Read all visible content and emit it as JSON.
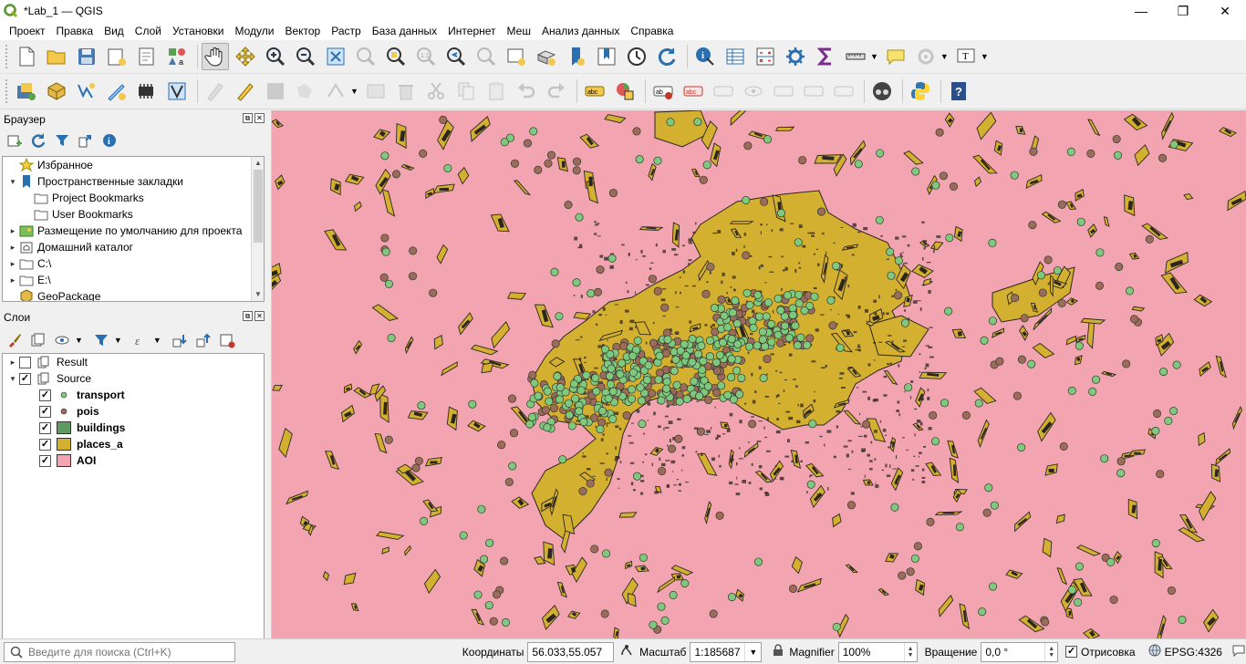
{
  "window": {
    "title": "*Lab_1 — QGIS",
    "minimize": "—",
    "maximize": "❐",
    "close": "✕"
  },
  "menu": [
    {
      "label": "Проект"
    },
    {
      "label": "Правка"
    },
    {
      "label": "Вид"
    },
    {
      "label": "Слой"
    },
    {
      "label": "Установки"
    },
    {
      "label": "Модули"
    },
    {
      "label": "Вектор"
    },
    {
      "label": "Растр"
    },
    {
      "label": "База данных"
    },
    {
      "label": "Интернет"
    },
    {
      "label": "Меш"
    },
    {
      "label": "Анализ данных"
    },
    {
      "label": "Справка"
    }
  ],
  "toolbar1": [
    "new-project-icon",
    "open-project-icon",
    "save-project-icon",
    "new-print-layout-icon",
    "layout-manager-icon",
    "style-manager-icon",
    "pan-icon",
    "pan-to-selection-icon",
    "zoom-in-icon",
    "zoom-out-icon",
    "zoom-full-icon",
    "zoom-to-selection-icon",
    "zoom-to-layer-icon",
    "zoom-native-icon",
    "zoom-last-icon",
    "zoom-next-icon",
    "new-map-view-icon",
    "new-3d-view-icon",
    "new-bookmark-icon",
    "show-bookmarks-icon",
    "temporal-controller-icon",
    "refresh-icon",
    "identify-icon",
    "attribute-table-icon",
    "field-calculator-icon",
    "processing-toolbox-icon",
    "statistics-icon",
    "measure-icon",
    "map-tips-icon",
    "select-icon",
    "text-annotation-icon"
  ],
  "toolbar2": [
    "data-source-manager-icon",
    "new-geopackage-layer-icon",
    "new-shapefile-layer-icon",
    "new-temporary-layer-icon",
    "new-spatialite-layer-icon",
    "digitize-toggle-icon",
    "current-edits-icon",
    "toggle-editing-icon",
    "save-edits-icon",
    "add-feature-icon",
    "vertex-tool-icon",
    "modify-attributes-icon",
    "delete-selected-icon",
    "cut-features-icon",
    "copy-features-icon",
    "paste-features-icon",
    "undo-icon",
    "redo-icon",
    "label-toolbar-icon",
    "diagram-icon",
    "layer-labeling-icon",
    "highlight-pinned-labels-icon",
    "pin-labels-icon",
    "show-hide-labels-icon",
    "move-label-icon",
    "rotate-label-icon",
    "change-label-icon",
    "osm-icon",
    "python-console-icon",
    "help-icon"
  ],
  "browser": {
    "title": "Браузер",
    "items": [
      {
        "label": "Избранное",
        "icon": "star-icon",
        "arrow": "",
        "indent": 0
      },
      {
        "label": "Пространственные закладки",
        "icon": "bookmarks-icon",
        "arrow": "▾",
        "indent": 0
      },
      {
        "label": "Project Bookmarks",
        "icon": "folder-icon",
        "arrow": "",
        "indent": 1
      },
      {
        "label": "User Bookmarks",
        "icon": "folder-icon",
        "arrow": "",
        "indent": 1
      },
      {
        "label": "Размещение по умолчанию для проекта",
        "icon": "project-home-icon",
        "arrow": "▸",
        "indent": 0
      },
      {
        "label": "Домашний каталог",
        "icon": "home-icon",
        "arrow": "▸",
        "indent": 0
      },
      {
        "label": "C:\\",
        "icon": "drive-icon",
        "arrow": "▸",
        "indent": 0
      },
      {
        "label": "E:\\",
        "icon": "drive-icon",
        "arrow": "▸",
        "indent": 0
      },
      {
        "label": "GeoPackage",
        "icon": "geopackage-icon",
        "arrow": "",
        "indent": 0
      }
    ]
  },
  "layers": {
    "title": "Слои",
    "groups": [
      {
        "label": "Result",
        "checked": false,
        "arrow": "▸"
      },
      {
        "label": "Source",
        "checked": true,
        "arrow": "▾"
      }
    ],
    "items": [
      {
        "label": "transport",
        "checked": true,
        "symbol": "point",
        "color": "#7fc97f"
      },
      {
        "label": "pois",
        "checked": true,
        "symbol": "point",
        "color": "#9c6b5a"
      },
      {
        "label": "buildings",
        "checked": true,
        "symbol": "fill",
        "color": "#5f9a63"
      },
      {
        "label": "places_a",
        "checked": true,
        "symbol": "fill",
        "color": "#d4b030"
      },
      {
        "label": "AOI",
        "checked": true,
        "symbol": "fill",
        "color": "#f2a5b0"
      }
    ]
  },
  "map": {
    "background": "#f2a5b0",
    "place_color": "#d4b030",
    "building_color": "#2b2620",
    "transport_color": "#7fc97f",
    "pois_color": "#9c6b5a"
  },
  "statusbar": {
    "search_placeholder": "Введите для поиска (Ctrl+K)",
    "coord_label": "Координаты",
    "coord_value": "56.033,55.057",
    "scale_label": "Масштаб",
    "scale_value": "1:185687",
    "magnifier_label": "Magnifier",
    "magnifier_value": "100%",
    "rotation_label": "Вращение",
    "rotation_value": "0,0 °",
    "render_label": "Отрисовка",
    "render_checked": true,
    "crs": "EPSG:4326"
  }
}
